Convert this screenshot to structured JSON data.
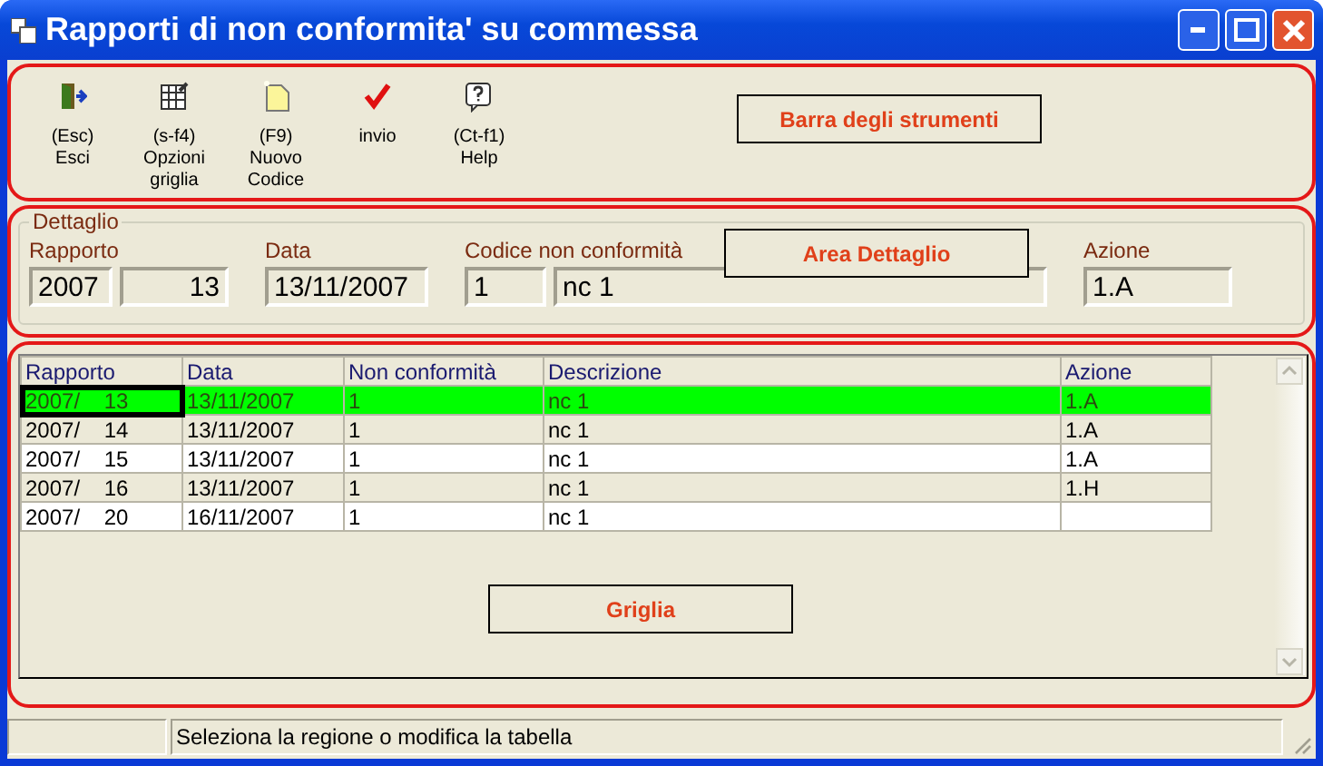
{
  "window": {
    "title": "Rapporti di non conformita' su commessa"
  },
  "toolbar": {
    "items": [
      {
        "kind": "exit",
        "lines": [
          "(Esc)",
          "Esci"
        ]
      },
      {
        "kind": "grid",
        "lines": [
          "(s-f4)",
          "Opzioni",
          "griglia"
        ]
      },
      {
        "kind": "new",
        "lines": [
          "(F9)",
          "Nuovo",
          "Codice"
        ]
      },
      {
        "kind": "check",
        "lines": [
          "invio"
        ]
      },
      {
        "kind": "help",
        "lines": [
          "(Ct-f1)",
          "Help"
        ]
      }
    ],
    "annotation": "Barra degli strumenti"
  },
  "detail": {
    "legend": "Dettaglio",
    "annotation": "Area Dettaglio",
    "rapporto_label": "Rapporto",
    "rapporto_year": "2007",
    "rapporto_number": "13",
    "data_label": "Data",
    "data": "13/11/2007",
    "codice_label": "Codice non conformità",
    "codice": "1",
    "descrizione": "nc 1",
    "azione_label": "Azione",
    "azione": "1.A"
  },
  "grid": {
    "annotation": "Griglia",
    "columns": [
      "Rapporto",
      "Data",
      "Non conformità",
      "Descrizione",
      "Azione"
    ],
    "rows": [
      {
        "selected": true,
        "cells": [
          "2007/    13",
          "13/11/2007",
          "1",
          "nc 1",
          "1.A"
        ]
      },
      {
        "selected": false,
        "cells": [
          "2007/    14",
          "13/11/2007",
          "1",
          "nc 1",
          "1.A"
        ]
      },
      {
        "selected": false,
        "cells": [
          "2007/    15",
          "13/11/2007",
          "1",
          "nc 1",
          "1.A"
        ]
      },
      {
        "selected": false,
        "cells": [
          "2007/    16",
          "13/11/2007",
          "1",
          "nc 1",
          "1.H"
        ]
      },
      {
        "selected": false,
        "cells": [
          "2007/    20",
          "16/11/2007",
          "1",
          "nc 1",
          ""
        ]
      }
    ]
  },
  "status_bar": {
    "text": "Seleziona la regione o modifica la tabella"
  }
}
